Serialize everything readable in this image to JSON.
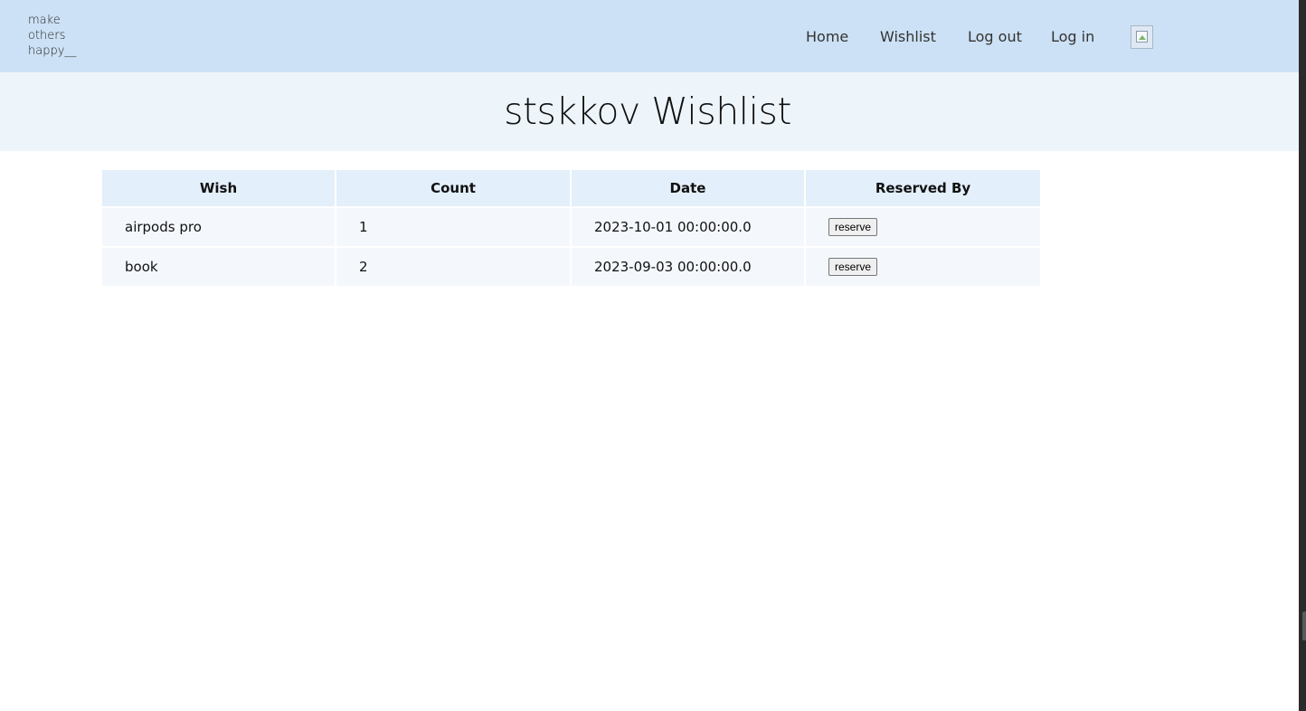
{
  "header": {
    "logo_lines": [
      "make",
      "others",
      "happy__"
    ],
    "nav": {
      "home": "Home",
      "wishlist": "Wishlist",
      "logout": "Log out",
      "login": "Log in"
    }
  },
  "title": "stskkov Wishlist",
  "table": {
    "columns": [
      "Wish",
      "Count",
      "Date",
      "Reserved By"
    ],
    "rows": [
      {
        "wish": "airpods pro",
        "count": "1",
        "date": "2023-10-01 00:00:00.0",
        "action": "reserve"
      },
      {
        "wish": "book",
        "count": "2",
        "date": "2023-09-03 00:00:00.0",
        "action": "reserve"
      }
    ]
  }
}
